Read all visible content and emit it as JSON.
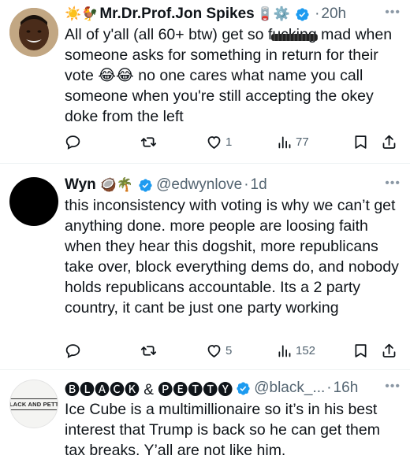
{
  "tweets": [
    {
      "prefix_emojis": "☀️🐓",
      "name": "Mr.Dr.Prof.Jon Spikes",
      "suffix_emojis": "🪫⚙️",
      "time": "20h",
      "body_before": "All of y'all (all 60+ btw) get so f",
      "body_scribbled": "ucking",
      "body_after": " mad when someone asks for something in return for their vote 😂😂 no one cares what name you call someone when you're still accepting the okey doke from the left",
      "likes": "1",
      "views": "77"
    },
    {
      "name": "Wyn",
      "suffix_emojis": "🥥🌴",
      "handle": "@edwynlove",
      "time": "1d",
      "body": "this inconsistency with voting is why we can’t get anything done. more people are loosing faith when they hear this dogshit, more republicans take over, block everything dems do, and nobody holds republicans accountable. Its a 2 party country, it cant be just one party working",
      "likes": "5",
      "views": "152"
    },
    {
      "avatar_text": "BLACK AND PETTY",
      "name": "🅑🅛🅐🅒🅚 & 🅟🅔🅣🅣🅨",
      "handle": "@black_...",
      "time": "16h",
      "body": "Ice Cube is a multimillionaire so it’s in his best interest that Trump is back so he can get them tax breaks. Y’all are not like him."
    }
  ],
  "separator": "·",
  "more_label": "•••",
  "colors": {
    "verified": "#1d9bf0",
    "icon": "#536471",
    "text": "#0f1419"
  },
  "icons": [
    "reply-icon",
    "retweet-icon",
    "like-icon",
    "views-icon",
    "bookmark-icon",
    "share-icon",
    "verified-icon",
    "more-icon"
  ]
}
